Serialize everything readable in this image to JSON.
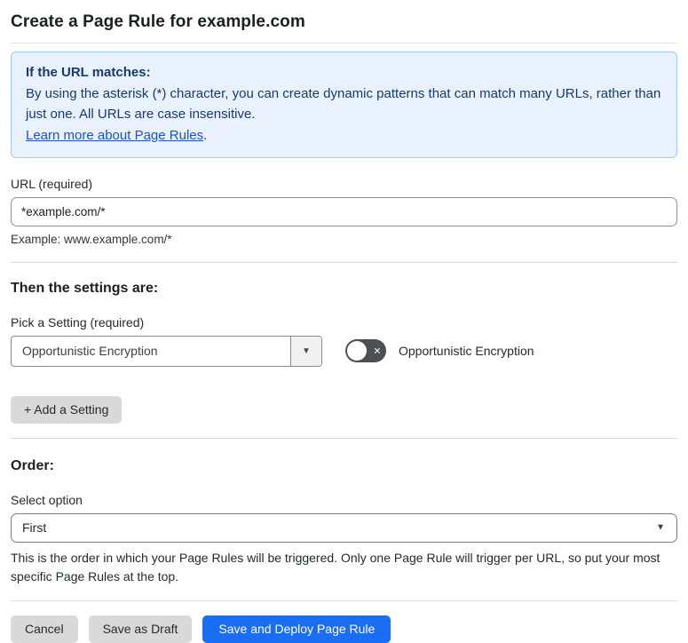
{
  "theme": {
    "primary": "#1a6ef5",
    "info_bg": "#e9f2fc",
    "info_border": "#abc9ee",
    "info_text": "#173a70",
    "link": "#2050c8"
  },
  "page": {
    "title": "Create a Page Rule for example.com"
  },
  "info_box": {
    "heading": "If the URL matches:",
    "body": "By using the asterisk (*) character, you can create dynamic patterns that can match many URLs, rather than just one. All URLs are case insensitive.",
    "link_label": "Learn more about Page Rules",
    "link_suffix": "."
  },
  "url_section": {
    "label": "URL (required)",
    "value": "*example.com/*",
    "example": "Example: www.example.com/*"
  },
  "settings_section": {
    "heading": "Then the settings are:",
    "picker_label": "Pick a Setting (required)",
    "selected_setting": "Opportunistic Encryption",
    "toggle_label": "Opportunistic Encryption",
    "toggle_state": "off",
    "add_button_label": "+ Add a Setting"
  },
  "order_section": {
    "heading": "Order:",
    "select_label": "Select option",
    "selected_option": "First",
    "help_text": "This is the order in which your Page Rules will be triggered. Only one Page Rule will trigger per URL, so put your most specific Page Rules at the top."
  },
  "footer": {
    "cancel_label": "Cancel",
    "save_draft_label": "Save as Draft",
    "save_deploy_label": "Save and Deploy Page Rule"
  },
  "icons": {
    "dropdown_arrow": "▼",
    "toggle_off_glyph": "×"
  }
}
